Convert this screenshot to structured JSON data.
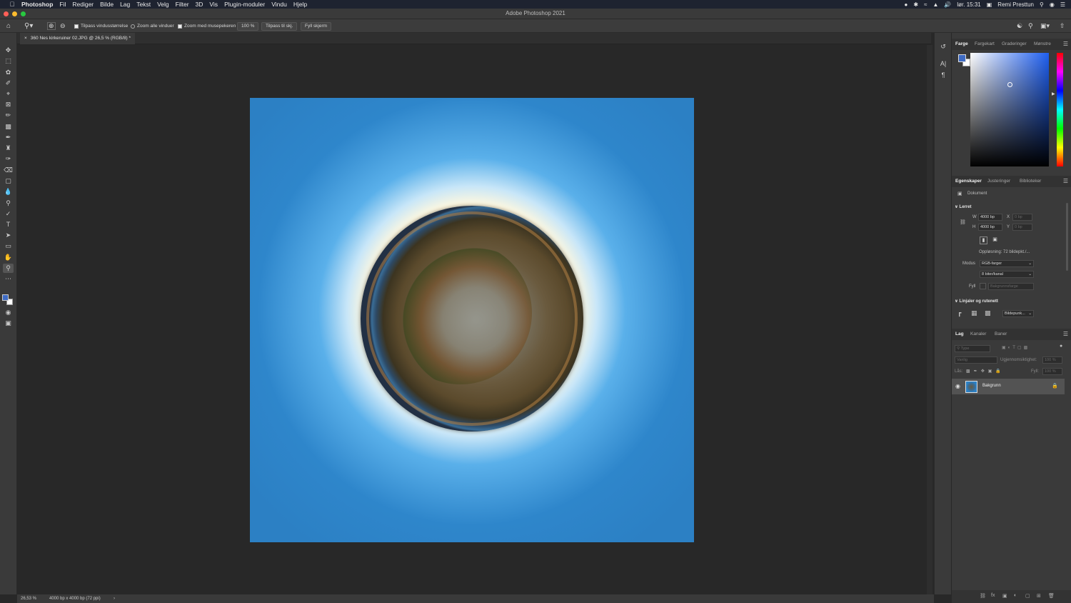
{
  "menubar": {
    "app": "Photoshop",
    "items": [
      "Fil",
      "Rediger",
      "Bilde",
      "Lag",
      "Tekst",
      "Velg",
      "Filter",
      "3D",
      "Vis",
      "Plugin-moduler",
      "Vindu",
      "Hjelp"
    ],
    "clock": "lør. 15:31",
    "user": "Remi Presttun"
  },
  "window": {
    "title": "Adobe Photoshop 2021"
  },
  "options": {
    "zoom_label": "",
    "resize_windows": "Tilpass vindusstørrelse",
    "zoom_all": "Zoom alle vinduer",
    "scrubby": "Zoom med musepekeren",
    "percent": "100 %",
    "fit_screen": "Tilpass til skj.",
    "fill_screen": "Fyll skjerm"
  },
  "document": {
    "tab": "360 Nes kirkeruiner 02.JPG @ 26,5 % (RGB/8) *"
  },
  "color_panel": {
    "tabs": [
      "Farge",
      "Fargekart",
      "Graderinger",
      "Mønstre"
    ],
    "foreground": "#3e6bc4",
    "background": "#ffffff"
  },
  "properties": {
    "tabs": [
      "Egenskaper",
      "Justeringer",
      "Biblioteker"
    ],
    "doc_label": "Dokument",
    "canvas_section": "Lerret",
    "w_label": "W",
    "w_value": "4000 bp",
    "h_label": "H",
    "h_value": "4000 bp",
    "x_label": "X",
    "x_value": "0 bp",
    "y_label": "Y",
    "y_value": "0 bp",
    "resolution": "Oppløsning: 72 bildepkt./...",
    "mode_label": "Modus",
    "mode_value": "RGB-farger",
    "depth_value": "8 biter/kanal",
    "fill_label": "Fyll",
    "fill_value": "Bakgrunnsfarge",
    "rulers_section": "Linjaler og rutenett",
    "units_value": "Bildepunk..."
  },
  "layers": {
    "tabs": [
      "Lag",
      "Kanaler",
      "Baner"
    ],
    "search_placeholder": "Type",
    "blend": "Vanlig",
    "opacity_label": "Ugjennomsiktighet:",
    "opacity_value": "100 %",
    "lock_label": "Lås:",
    "fill_label": "Fyll:",
    "fill_value": "100 %",
    "items": [
      {
        "name": "Bakgrunn"
      }
    ]
  },
  "status": {
    "zoom": "26,53 %",
    "info": "4000 bp x 4000 bp (72 ppi)"
  }
}
